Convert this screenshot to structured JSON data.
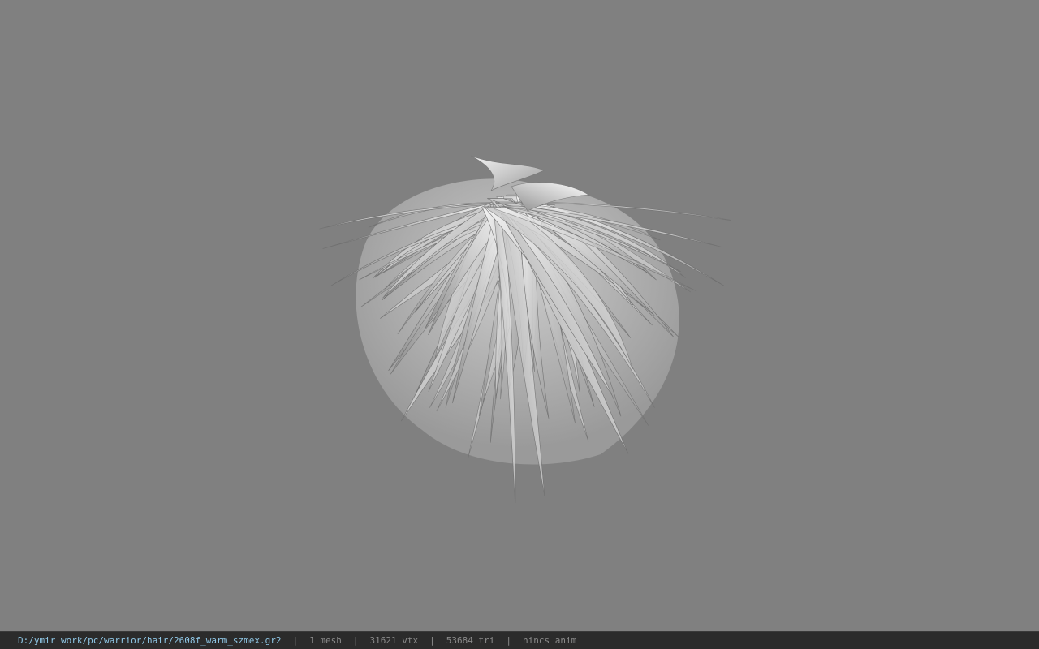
{
  "viewport": {
    "background": "#808080",
    "model_icon": "hair-mesh-icon"
  },
  "status_bar": {
    "file_path": "D:/ymir work/pc/warrior/hair/2608f_warm_szmex.gr2",
    "separator": "|",
    "mesh_count": "1 mesh",
    "vertex_count": "31621 vtx",
    "triangle_count": "53684 tri",
    "anim_status": "nincs anim",
    "path_color": "#8fc7e6",
    "text_color": "#8a8a8a"
  }
}
